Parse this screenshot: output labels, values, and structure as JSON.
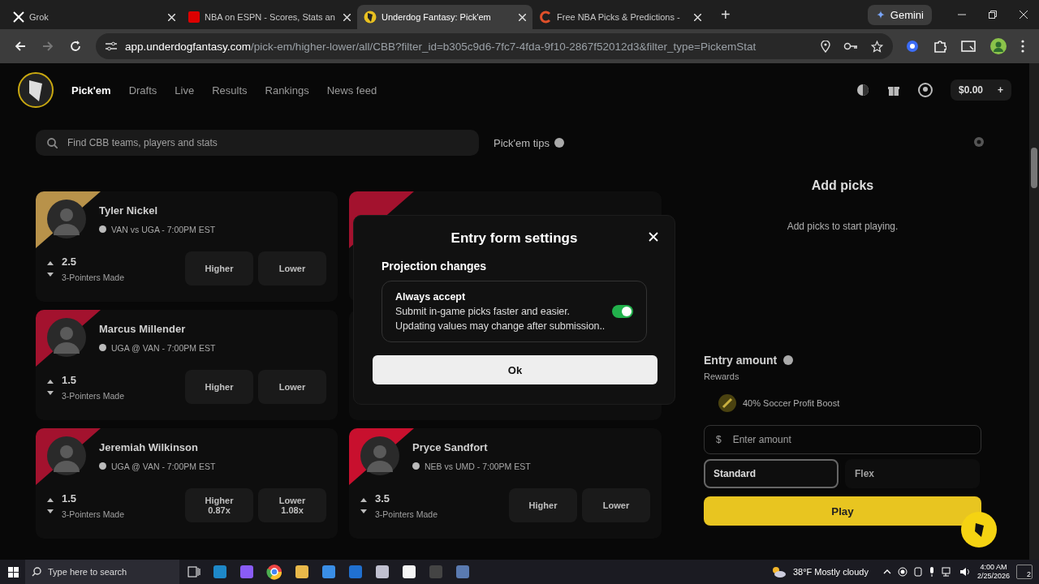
{
  "browser": {
    "tabs": [
      {
        "title": "Grok",
        "selected": false
      },
      {
        "title": "NBA on ESPN - Scores, Stats an",
        "selected": false
      },
      {
        "title": "Underdog Fantasy: Pick'em",
        "selected": true
      },
      {
        "title": "Free NBA Picks & Predictions -",
        "selected": false
      }
    ],
    "new_tab": "+",
    "gemini": "Gemini",
    "url_host": "app.underdogfantasy.com",
    "url_path": "/pick-em/higher-lower/all/CBB?filter_id=b305c9d6-7fc7-4fda-9f10-2867f52012d3&filter_type=PickemStat"
  },
  "site": {
    "nav": [
      {
        "label": "Pick'em",
        "selected": true
      },
      {
        "label": "Drafts",
        "selected": false
      },
      {
        "label": "Live",
        "selected": false
      },
      {
        "label": "Results",
        "selected": false
      },
      {
        "label": "Rankings",
        "selected": false
      },
      {
        "label": "News feed",
        "selected": false
      }
    ],
    "balance": "$0.00",
    "add": "+",
    "search": {
      "placeholder": "Find CBB teams, players and stats"
    },
    "tips": "Pick'em tips",
    "cards": [
      {
        "kind": "player",
        "player": "Tyler Nickel",
        "game": "VAN vs UGA - 7:00PM EST",
        "line": "2.5",
        "stat": "3-Pointers Made",
        "higher": "Higher",
        "lower": "Lower",
        "color": "#b8924a"
      },
      {
        "kind": "covered",
        "color": "#a3122e"
      },
      {
        "kind": "player",
        "player": "Marcus Millender",
        "game": "UGA @ VAN - 7:00PM EST",
        "line": "1.5",
        "stat": "3-Pointers Made",
        "higher": "Higher",
        "lower": "Lower",
        "color": "#a3122e"
      },
      {
        "kind": "covered"
      },
      {
        "kind": "player",
        "player": "Jeremiah Wilkinson",
        "game": "UGA @ VAN - 7:00PM EST",
        "line": "1.5",
        "stat": "3-Pointers Made",
        "higher": "Higher",
        "higher_mult": "0.87x",
        "lower": "Lower",
        "lower_mult": "1.08x",
        "color": "#a3122e"
      },
      {
        "kind": "player",
        "player": "Pryce Sandfort",
        "game": "NEB vs UMD - 7:00PM EST",
        "line": "3.5",
        "stat": "3-Pointers Made",
        "higher": "Higher",
        "lower": "Lower",
        "color": "#c8102e"
      }
    ],
    "slip": {
      "title": "Add picks",
      "subtitle": "Add picks to start playing.",
      "entry_label": "Entry amount",
      "rewards": "Rewards",
      "boost": "40% Soccer Profit Boost",
      "currency": "$",
      "amount_placeholder": "Enter amount",
      "modes": [
        {
          "label": "Standard",
          "selected": true
        },
        {
          "label": "Flex",
          "selected": false
        }
      ],
      "play": "Play"
    }
  },
  "modal": {
    "title": "Entry form settings",
    "section": "Projection changes",
    "option": {
      "title": "Always accept",
      "line_1": "Submit in-game picks faster and easier.",
      "line_2": "Updating values may change after submission..",
      "on": true
    },
    "ok": "Ok"
  },
  "taskbar": {
    "search_placeholder": "Type here to search",
    "weather": "38°F  Mostly cloudy",
    "time": "4:00 AM",
    "date": "2/25/2026",
    "notifications": "2"
  }
}
